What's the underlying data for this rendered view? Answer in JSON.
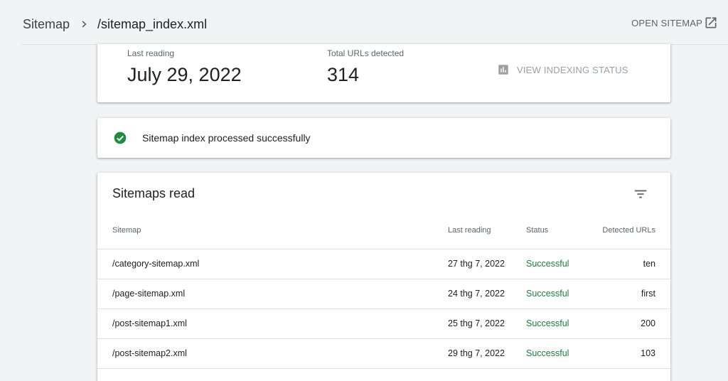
{
  "header": {
    "breadcrumb_root": "Sitemap",
    "breadcrumb_current": "/sitemap_index.xml",
    "open_label": "OPEN SITEMAP"
  },
  "summary": {
    "last_reading_label": "Last reading",
    "last_reading_value": "July 29, 2022",
    "total_urls_label": "Total URLs detected",
    "total_urls_value": "314",
    "view_indexing_label": "VIEW INDEXING STATUS"
  },
  "status": {
    "text": "Sitemap index processed successfully",
    "color": "#1e8e3e"
  },
  "table": {
    "title": "Sitemaps read",
    "columns": [
      "Sitemap",
      "Last reading",
      "Status",
      "Detected URLs"
    ],
    "rows": [
      {
        "sitemap": "/category-sitemap.xml",
        "last_reading": "27 thg 7, 2022",
        "status": "Successful",
        "urls": "ten"
      },
      {
        "sitemap": "/page-sitemap.xml",
        "last_reading": "24 thg 7, 2022",
        "status": "Successful",
        "urls": "first"
      },
      {
        "sitemap": "/post-sitemap1.xml",
        "last_reading": "25 thg 7, 2022",
        "status": "Successful",
        "urls": "200"
      },
      {
        "sitemap": "/post-sitemap2.xml",
        "last_reading": "29 thg 7, 2022",
        "status": "Successful",
        "urls": "103"
      }
    ]
  },
  "colors": {
    "success": "#188038",
    "muted": "#5f6368",
    "disabled": "#9aa0a6"
  },
  "icons": [
    "chevron-right-icon",
    "open-in-new-icon",
    "bar-chart-icon",
    "check-circle-icon",
    "filter-icon"
  ]
}
